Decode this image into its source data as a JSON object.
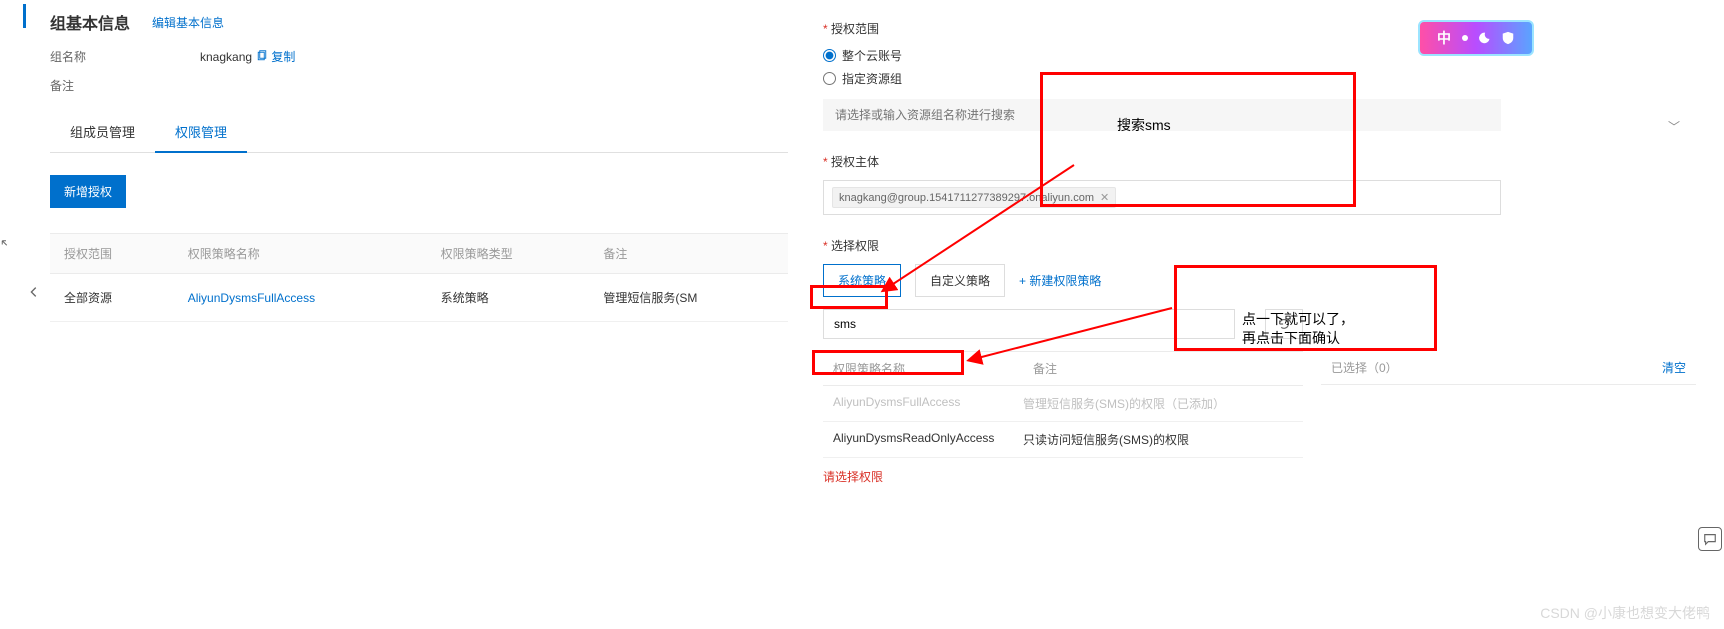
{
  "left": {
    "title": "组基本信息",
    "edit": "编辑基本信息",
    "fields": {
      "name_label": "组名称",
      "name_value": "knagkang",
      "copy": "复制",
      "remark_label": "备注"
    },
    "tabs": {
      "t1": "组成员管理",
      "t2": "权限管理"
    },
    "add_btn": "新增授权",
    "table": {
      "h1": "授权范围",
      "h2": "权限策略名称",
      "h3": "权限策略类型",
      "h4": "备注",
      "r1": {
        "c1": "全部资源",
        "c2": "AliyunDysmsFullAccess",
        "c3": "系统策略",
        "c4": "管理短信服务(SM"
      }
    }
  },
  "drawer": {
    "scope_label": "授权范围",
    "radio_all": "整个云账号",
    "radio_group": "指定资源组",
    "resource_placeholder": "请选择或输入资源组名称进行搜索",
    "principal_label": "授权主体",
    "principal_value": "knagkang@group.1541711277389297.onaliyun.com",
    "select_label": "选择权限",
    "tab_sys": "系统策略",
    "tab_custom": "自定义策略",
    "create_link": "+ 新建权限策略",
    "search_value": "sms",
    "col_name": "权限策略名称",
    "col_note": "备注",
    "rows": {
      "r1": {
        "name": "AliyunDysmsFullAccess",
        "note": "管理短信服务(SMS)的权限（已添加）"
      },
      "r2": {
        "name": "AliyunDysmsReadOnlyAccess",
        "note": "只读访问短信服务(SMS)的权限"
      }
    },
    "error": "请选择权限",
    "selected_label": "已选择（0）",
    "clear": "清空"
  },
  "anno": {
    "a1": "搜索sms",
    "a2_l1": "点一下就可以了，",
    "a2_l2": "再点击下面确认"
  },
  "overlay": {
    "badge_text": "中"
  },
  "watermark": "CSDN @小康也想变大佬鸭"
}
